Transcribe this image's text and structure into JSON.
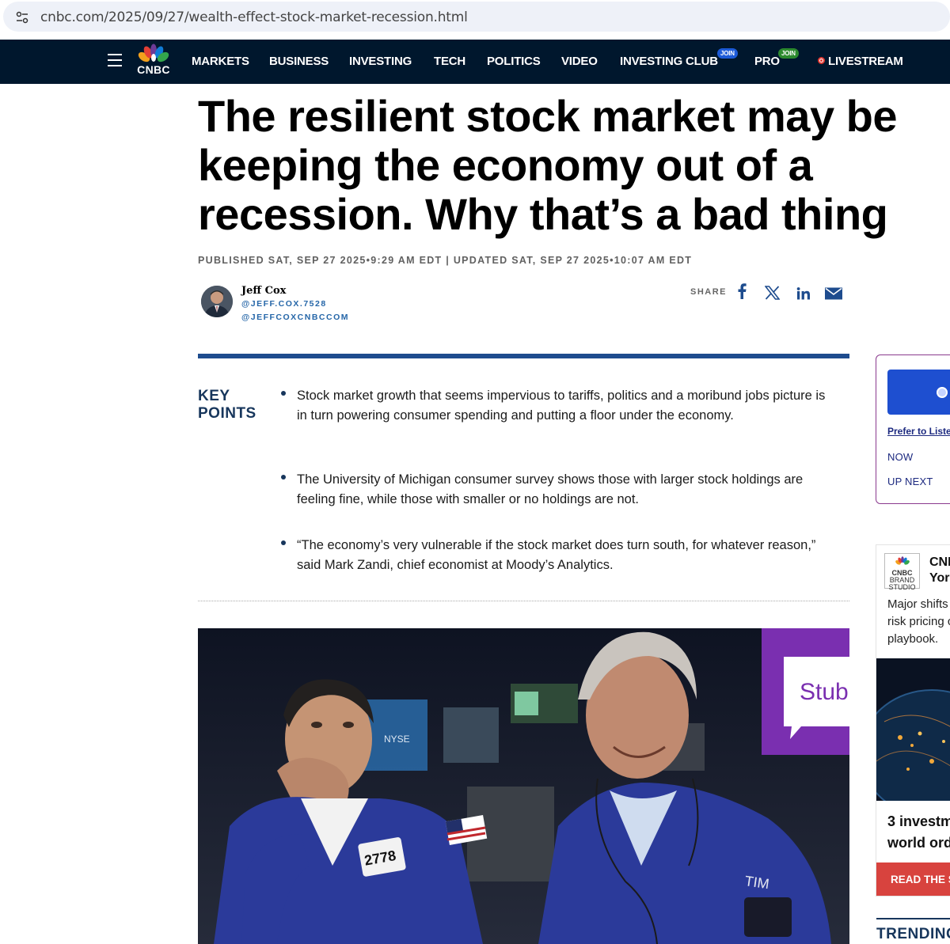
{
  "browser": {
    "url": "cnbc.com/2025/09/27/wealth-effect-stock-market-recession.html",
    "site_info_icon": "tune-icon"
  },
  "nav": {
    "logo_text": "CNBC",
    "items": [
      "MARKETS",
      "BUSINESS",
      "INVESTING",
      "TECH",
      "POLITICS",
      "VIDEO",
      "INVESTING CLUB",
      "PRO"
    ],
    "join_badge": "JOIN",
    "livestream": "LIVESTREAM",
    "colors": {
      "bar": "#00172d",
      "live": "#e23a33",
      "club_join": "#1d5bd8",
      "pro_join": "#2c8a2e"
    }
  },
  "article": {
    "headline_lines": [
      "The resilient stock market may be",
      "keeping the economy out of a",
      "recession. Why that’s a bad thing"
    ],
    "published": "PUBLISHED SAT, SEP 27 2025•9:29 AM EDT | UPDATED SAT, SEP 27 2025•10:07 AM EDT",
    "author": {
      "name": "Jeff Cox",
      "handle1": "@JEFF.COX.7528",
      "handle2": "@JEFFCOXCNBCCOM"
    },
    "share_label": "SHARE",
    "share_icons": [
      "facebook-icon",
      "x-icon",
      "linkedin-icon",
      "email-icon"
    ]
  },
  "key_points": {
    "title_line1": "KEY",
    "title_line2": "POINTS",
    "items": [
      "Stock market growth that seems impervious to tariffs, politics and a moribund jobs picture is in turn powering consumer spending and putting a floor under the economy.",
      "The University of Michigan consumer survey shows those with larger stock holdings are feeling fine, while those with smaller or no holdings are not.",
      "“The economy’s very vulnerable if the stock market does turn south, for whatever reason,” said Mark Zandi, chief economist at Moody’s Analytics."
    ]
  },
  "photo": {
    "badge_number": "2778",
    "sign_text": "Stubl",
    "jacket_name": "TIM",
    "screen_text": "NYSE"
  },
  "rail": {
    "audio": {
      "prefer": "Prefer to Liste",
      "now": "NOW",
      "up_next": "UP NEXT"
    },
    "brand": {
      "logo_lines": [
        "CNBC",
        "BRAND",
        "STUDIO"
      ],
      "name_line1": "CNE",
      "name_line2": "Yorl",
      "desc_lines": [
        "Major shifts",
        "risk pricing c",
        "playbook."
      ],
      "title_lines": [
        "3 investm",
        "world ord"
      ],
      "cta": "READ THE S"
    },
    "trending": "TRENDING"
  }
}
